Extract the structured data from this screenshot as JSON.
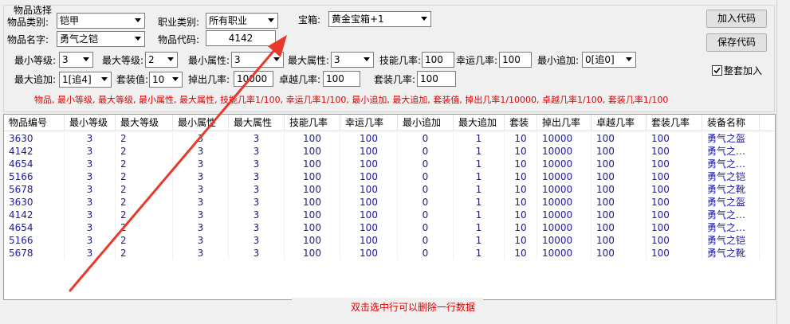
{
  "group": {
    "title": "物品选择"
  },
  "filters": {
    "category_label": "物品类别:",
    "category_value": "铠甲",
    "job_label": "职业类别:",
    "job_value": "所有职业",
    "chest_label": "宝箱:",
    "chest_value": "黄金宝箱+1",
    "name_label": "物品名字:",
    "name_value": "勇气之铠",
    "code_label": "物品代码:",
    "code_value": "4142"
  },
  "params": {
    "min_level_label": "最小等级:",
    "min_level_value": "3",
    "max_level_label": "最大等级:",
    "max_level_value": "2",
    "min_attr_label": "最小属性:",
    "min_attr_value": "3",
    "max_attr_label": "最大属性:",
    "max_attr_value": "3",
    "skill_rate_label": "技能几率:",
    "skill_rate_value": "100",
    "luck_rate_label": "幸运几率:",
    "luck_rate_value": "100",
    "min_add_label": "最小追加:",
    "min_add_value": "0[追0]",
    "max_add_label": "最大追加:",
    "max_add_value": "1[追4]",
    "set_value_label": "套装值:",
    "set_value_value": "10",
    "drop_rate_label": "掉出几率:",
    "drop_rate_value": "10000",
    "excellent_rate_label": "卓越几率:",
    "excellent_rate_value": "100",
    "set_rate_label": "套装几率:",
    "set_rate_value": "100"
  },
  "buttons": {
    "add_code": "加入代码",
    "save_code": "保存代码"
  },
  "set_add": {
    "label": "整套加入",
    "checked": true
  },
  "format_hint": "物品, 最小等级, 最大等级, 最小属性, 最大属性, 技能几率1/100, 幸运几率1/100, 最小追加, 最大追加, 套装值, 掉出几率1/10000, 卓越几率1/100, 套装几率1/100",
  "table": {
    "columns": [
      "物品编号",
      "最小等级",
      "最大等级",
      "最小属性",
      "最大属性",
      "技能几率",
      "幸运几率",
      "最小追加",
      "最大追加",
      "套装",
      "掉出几率",
      "卓越几率",
      "套装几率",
      "装备名称"
    ],
    "rows": [
      [
        "3630",
        "3",
        "2",
        "3",
        "3",
        "100",
        "100",
        "0",
        "1",
        "10",
        "10000",
        "100",
        "100",
        "勇气之盔"
      ],
      [
        "4142",
        "3",
        "2",
        "3",
        "3",
        "100",
        "100",
        "0",
        "1",
        "10",
        "10000",
        "100",
        "100",
        "勇气之…"
      ],
      [
        "4654",
        "3",
        "2",
        "3",
        "3",
        "100",
        "100",
        "0",
        "1",
        "10",
        "10000",
        "100",
        "100",
        "勇气之…"
      ],
      [
        "5166",
        "3",
        "2",
        "3",
        "3",
        "100",
        "100",
        "0",
        "1",
        "10",
        "10000",
        "100",
        "100",
        "勇气之铠"
      ],
      [
        "5678",
        "3",
        "2",
        "3",
        "3",
        "100",
        "100",
        "0",
        "1",
        "10",
        "10000",
        "100",
        "100",
        "勇气之靴"
      ],
      [
        "3630",
        "3",
        "2",
        "3",
        "3",
        "100",
        "100",
        "0",
        "1",
        "10",
        "10000",
        "100",
        "100",
        "勇气之盔"
      ],
      [
        "4142",
        "3",
        "2",
        "3",
        "3",
        "100",
        "100",
        "0",
        "1",
        "10",
        "10000",
        "100",
        "100",
        "勇气之…"
      ],
      [
        "4654",
        "3",
        "2",
        "3",
        "3",
        "100",
        "100",
        "0",
        "1",
        "10",
        "10000",
        "100",
        "100",
        "勇气之…"
      ],
      [
        "5166",
        "3",
        "2",
        "3",
        "3",
        "100",
        "100",
        "0",
        "1",
        "10",
        "10000",
        "100",
        "100",
        "勇气之铠"
      ],
      [
        "5678",
        "3",
        "2",
        "3",
        "3",
        "100",
        "100",
        "0",
        "1",
        "10",
        "10000",
        "100",
        "100",
        "勇气之靴"
      ]
    ]
  },
  "footer_hint": "双击选中行可以删除一行数据",
  "colors": {
    "hint_red": "#e00000",
    "cell_blue": "#1a1aa0",
    "arrow_red": "#e83a2c"
  }
}
